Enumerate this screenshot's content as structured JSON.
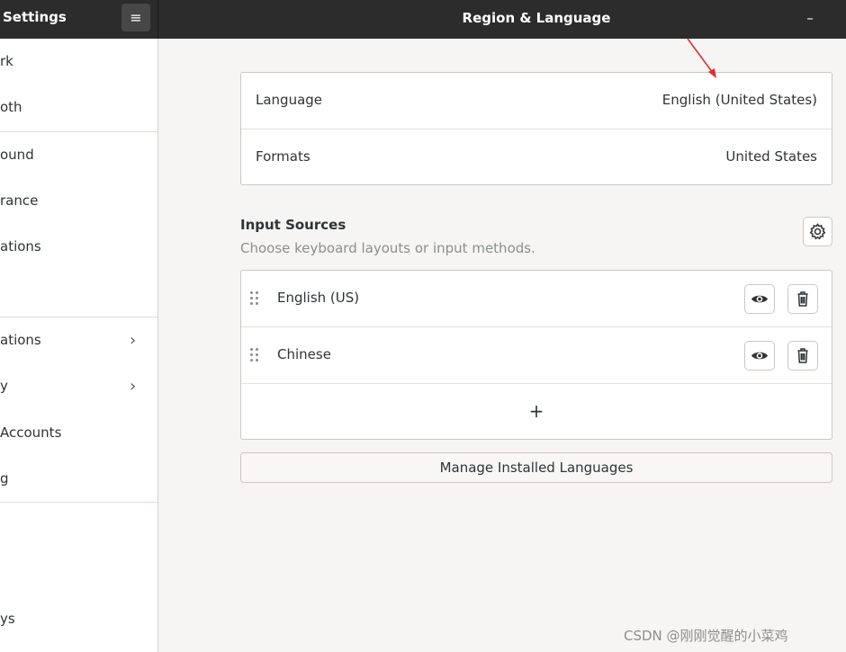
{
  "header": {
    "app_title": "Settings",
    "menu_icon": "hamburger-icon",
    "page_title": "Region & Language",
    "minimize_label": "–"
  },
  "sidebar": {
    "items": [
      {
        "label": "rk"
      },
      {
        "label": "oth"
      },
      {
        "label": "ound"
      },
      {
        "label": "rance"
      },
      {
        "label": "ations"
      },
      {
        "label": "ations",
        "chevron": "›"
      },
      {
        "label": "y",
        "chevron": "›"
      },
      {
        "label": "Accounts"
      },
      {
        "label": "g"
      },
      {
        "label": "ys"
      }
    ]
  },
  "region": {
    "language_label": "Language",
    "language_value": "English (United States)",
    "formats_label": "Formats",
    "formats_value": "United States"
  },
  "input_sources": {
    "title": "Input Sources",
    "subtitle": "Choose keyboard layouts or input methods.",
    "sources": [
      {
        "name": "English (US)"
      },
      {
        "name": "Chinese"
      }
    ],
    "add_label": "+"
  },
  "manage_button_label": "Manage Installed Languages",
  "watermark": "CSDN @刚刚觉醒的小菜鸡",
  "colors": {
    "header_bg": "#2c2c2c",
    "window_bg": "#f6f5f4",
    "annotation_arrow": "#e0302a"
  }
}
